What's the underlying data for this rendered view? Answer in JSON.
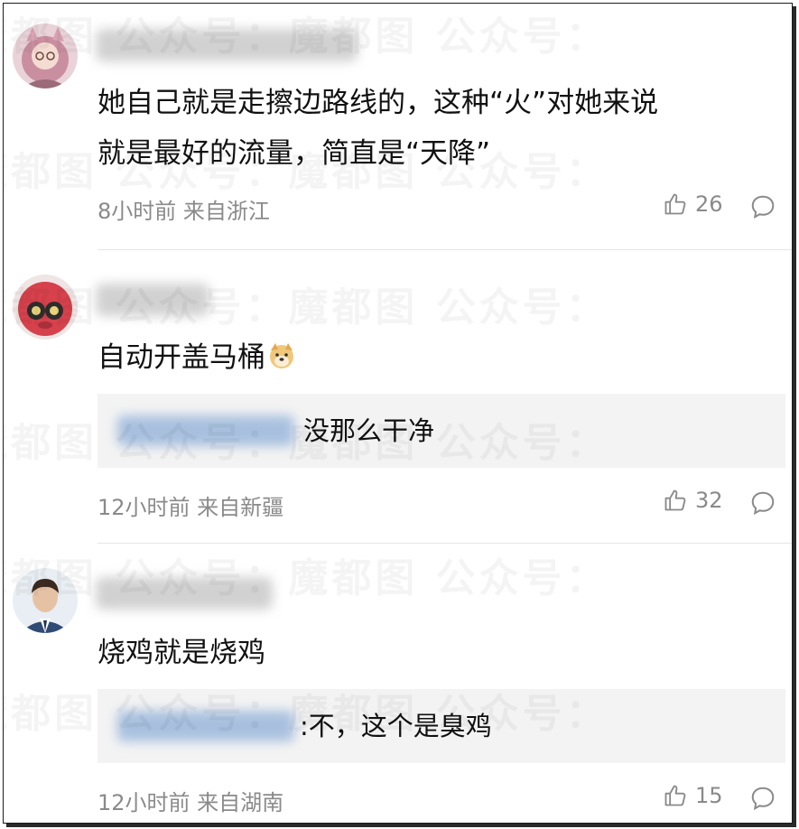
{
  "comments": [
    {
      "text": "她自己就是走擦边路线的，这种“火”对她来说就是最好的流量，简直是“天降”",
      "text_line1": "她自己就是走擦边路线的，这种“火”对她来说",
      "text_line2": "就是最好的流量，简直是“天降”",
      "meta": "8小时前 来自浙江",
      "likes": "26",
      "avatar": "avatar-girl-cat-ears"
    },
    {
      "text": "自动开盖马桶",
      "emoji": "doge-emoji",
      "reply": "没那么干净",
      "meta": "12小时前 来自新疆",
      "likes": "32",
      "avatar": "avatar-red-cartoon"
    },
    {
      "text": "烧鸡就是烧鸡",
      "reply": ":不，这个是臭鸡",
      "meta": "12小时前 来自湖南",
      "likes": "15",
      "avatar": "avatar-man-suit"
    }
  ],
  "watermark": "魔都图  公众号：魔都图  公众号：",
  "colors": {
    "meta": "#8a8a8a",
    "reply_bg": "#f3f3f3",
    "divider": "#e6e6e6"
  }
}
